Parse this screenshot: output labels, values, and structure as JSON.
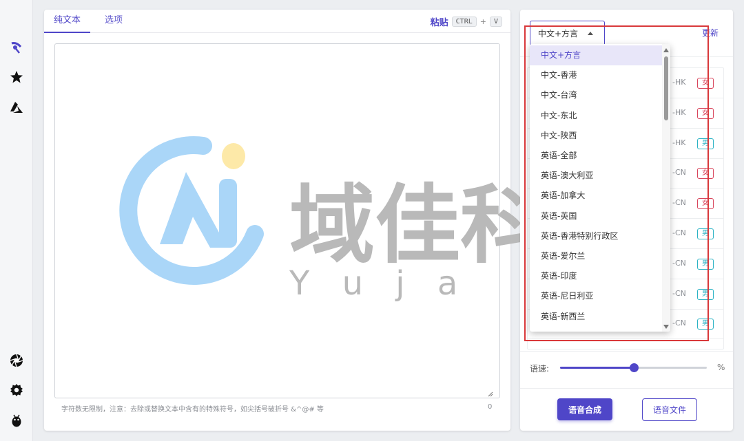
{
  "colors": {
    "accent": "#4f46c8",
    "female": "#d9455c",
    "male": "#2bb3c4",
    "highlight": "#d9383a"
  },
  "rail": {
    "icons": [
      "voice-tool-icon",
      "star-icon",
      "azure-icon",
      "aperture-icon",
      "gear-icon",
      "bug-icon"
    ]
  },
  "editor": {
    "tabs": [
      "纯文本",
      "选项"
    ],
    "paste_label": "粘贴",
    "shortcut_ctrl": "CTRL",
    "shortcut_plus": "+",
    "shortcut_key": "V",
    "text_value": "",
    "hint": "字符数无限制，注意：去除或替换文本中含有的特殊符号，如尖括号破折号 &^@# 等",
    "char_count": "0"
  },
  "watermark": {
    "brand_cn": "域佳科技",
    "brand_en": "Y u j a"
  },
  "settings": {
    "language_selected": "中文+方言",
    "refresh_label": "更新",
    "speed_label": "语速:",
    "speed_unit": "%",
    "speed_value": 0.5,
    "synthesize_button": "语音合成",
    "file_button": "语音文件"
  },
  "language_options": [
    "中文+方言",
    "中文-香港",
    "中文-台湾",
    "中文-东北",
    "中文-陕西",
    "英语-全部",
    "英语-澳大利亚",
    "英语-加拿大",
    "英语-英国",
    "英语-香港特别行政区",
    "英语-爱尔兰",
    "英语-印度",
    "英语-尼日利亚",
    "英语-新西兰"
  ],
  "voice_rows": [
    {
      "code": "-HK",
      "gender": "女",
      "kind": "f"
    },
    {
      "code": "-HK",
      "gender": "女",
      "kind": "f"
    },
    {
      "code": "-HK",
      "gender": "男",
      "kind": "m"
    },
    {
      "code": "-CN",
      "gender": "女",
      "kind": "f"
    },
    {
      "code": "-CN",
      "gender": "女",
      "kind": "f"
    },
    {
      "code": "-CN",
      "gender": "男",
      "kind": "m"
    },
    {
      "code": "-CN",
      "gender": "男",
      "kind": "m"
    },
    {
      "code": "-CN",
      "gender": "男",
      "kind": "m"
    },
    {
      "code": "-CN",
      "gender": "男",
      "kind": "m"
    }
  ]
}
